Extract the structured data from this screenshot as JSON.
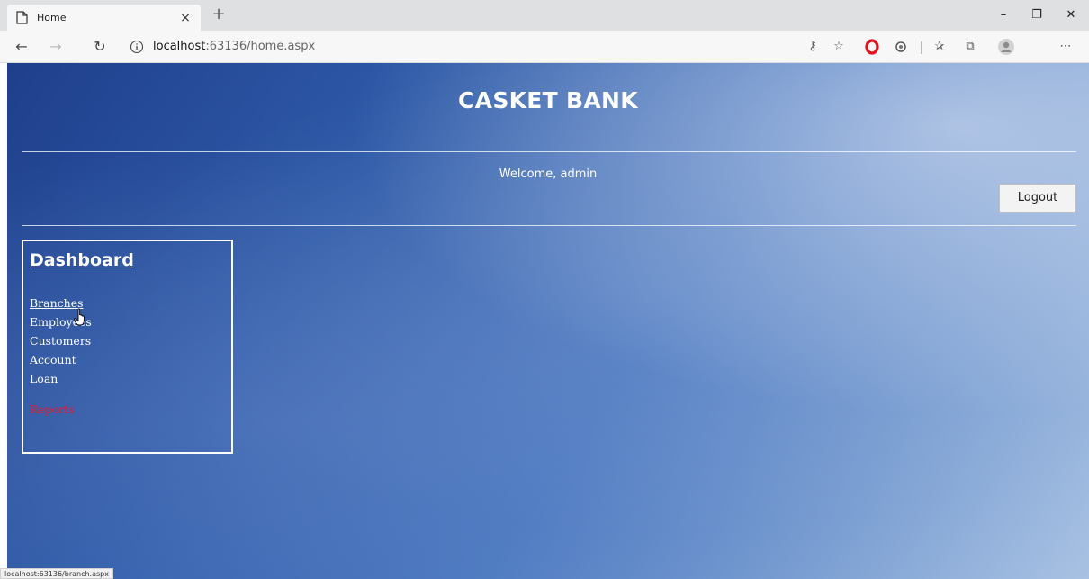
{
  "browser": {
    "tab_title": "Home",
    "tab_close": "×",
    "new_tab": "+",
    "address_host": "localhost",
    "address_path": ":63136/home.aspx",
    "status_url": "localhost:63136/branch.aspx",
    "icons": [
      "page-icon",
      "back-icon",
      "forward-icon",
      "refresh-icon",
      "info-icon",
      "key-icon",
      "star-icon",
      "opera-icon",
      "extension-icon",
      "favorites-icon",
      "collections-icon",
      "profile-icon",
      "more-icon",
      "minimize-icon",
      "restore-icon",
      "close-icon"
    ]
  },
  "header": {
    "title": "CASKET BANK",
    "welcome": "Welcome, admin",
    "logout_label": "Logout"
  },
  "dashboard": {
    "heading": "Dashboard",
    "items": [
      {
        "label": "Branches"
      },
      {
        "label": "Employees"
      },
      {
        "label": "Customers"
      },
      {
        "label": "Account"
      },
      {
        "label": "Loan"
      }
    ],
    "reports_label": "Reports"
  },
  "colors": {
    "reports_link": "#e8182a",
    "background_dark": "#1f3f8c",
    "background_light": "#a9c2e3"
  }
}
